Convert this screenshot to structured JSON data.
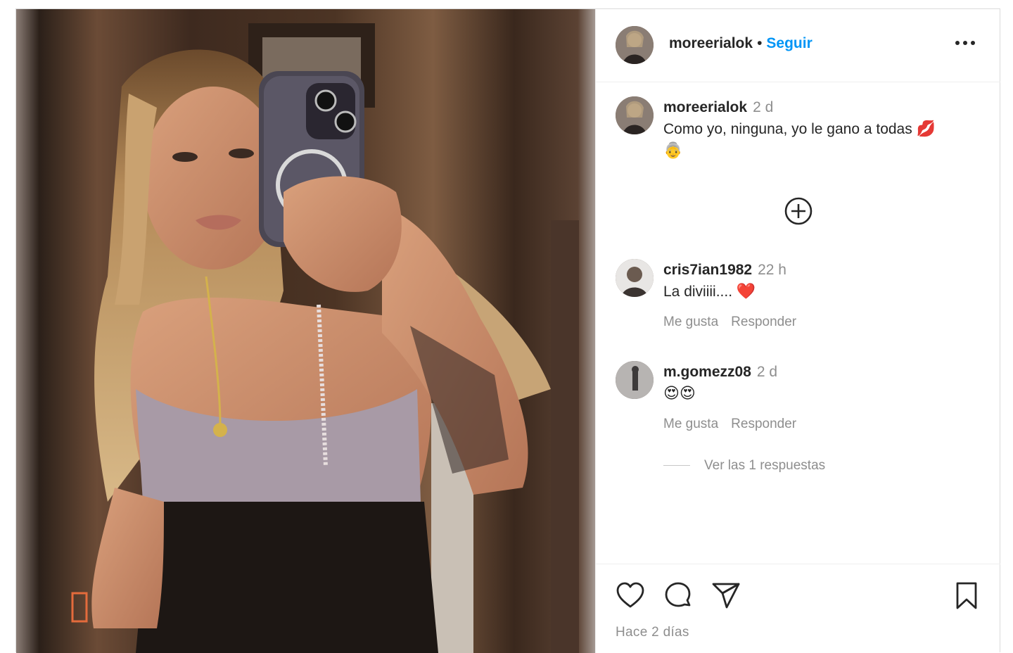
{
  "post": {
    "author": "moreerialok",
    "separator": "•",
    "follow_label": "Seguir",
    "caption": {
      "username": "moreerialok",
      "time": "2 d",
      "text": "Como yo, ninguna, yo le gano a todas",
      "emoji_1": "💋",
      "emoji_2": "👵"
    },
    "comments": [
      {
        "username": "cris7ian1982",
        "time": "22 h",
        "text": "La diviiii....",
        "emoji": "❤️",
        "like_label": "Me gusta",
        "reply_label": "Responder"
      },
      {
        "username": "m.gomezz08",
        "time": "2 d",
        "text": "",
        "emoji": "😍😍",
        "like_label": "Me gusta",
        "reply_label": "Responder"
      }
    ],
    "view_replies": "Ver las 1 respuestas",
    "date": "Hace 2 días"
  },
  "icons": {
    "more": "more-horizontal-icon",
    "add": "add-circle-icon",
    "like": "heart-icon",
    "comment": "comment-icon",
    "share": "send-icon",
    "save": "bookmark-icon"
  },
  "colors": {
    "accent": "#0095f6",
    "text": "#262626",
    "muted": "#8e8e8e",
    "heart": "#ed1c24"
  }
}
